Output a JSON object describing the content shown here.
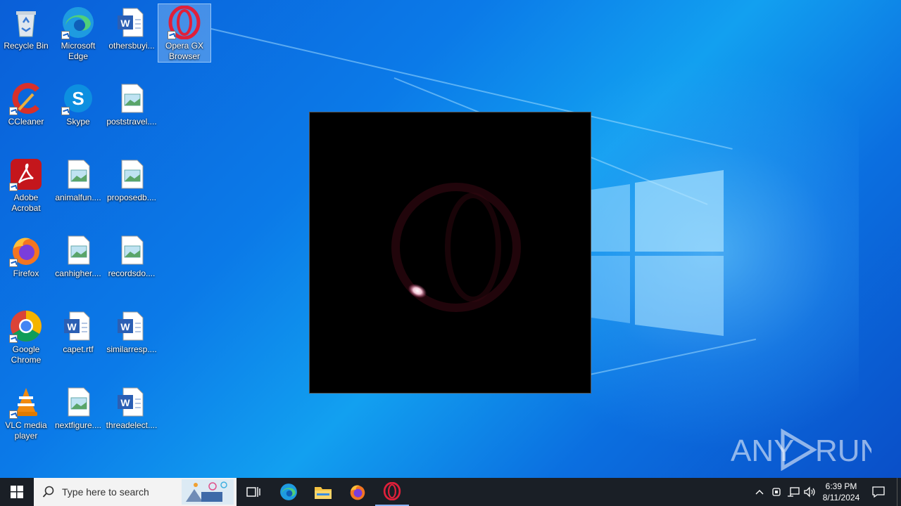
{
  "desktop": {
    "icons": [
      {
        "label": "Recycle Bin",
        "icon": "recycle-bin-icon"
      },
      {
        "label": "Microsoft Edge",
        "icon": "edge-icon"
      },
      {
        "label": "othersbuyi...",
        "icon": "word-document-icon"
      },
      {
        "label": "Opera GX Browser",
        "icon": "opera-gx-icon"
      },
      {
        "label": "CCleaner",
        "icon": "ccleaner-icon"
      },
      {
        "label": "Skype",
        "icon": "skype-icon"
      },
      {
        "label": "poststravel....",
        "icon": "image-file-icon"
      },
      {
        "label": "Adobe Acrobat",
        "icon": "adobe-acrobat-icon"
      },
      {
        "label": "animalfun....",
        "icon": "image-file-icon"
      },
      {
        "label": "proposedb....",
        "icon": "image-file-icon"
      },
      {
        "label": "Firefox",
        "icon": "firefox-icon"
      },
      {
        "label": "canhigher....",
        "icon": "image-file-icon"
      },
      {
        "label": "recordsdo....",
        "icon": "image-file-icon"
      },
      {
        "label": "Google Chrome",
        "icon": "chrome-icon"
      },
      {
        "label": "capet.rtf",
        "icon": "word-document-icon"
      },
      {
        "label": "similarresp....",
        "icon": "word-document-icon"
      },
      {
        "label": "VLC media player",
        "icon": "vlc-icon"
      },
      {
        "label": "nextfigure....",
        "icon": "image-file-icon"
      },
      {
        "label": "threadelect....",
        "icon": "word-document-icon"
      }
    ]
  },
  "watermark": {
    "text": "ANY RUN"
  },
  "taskbar": {
    "search_placeholder": "Type here to search",
    "pinned": [
      "task-view-icon",
      "edge-icon",
      "file-explorer-icon",
      "firefox-icon",
      "opera-gx-icon"
    ],
    "clock": {
      "time": "6:39 PM",
      "date": "8/11/2024"
    }
  },
  "colors": {
    "desktop_blue": "#0b7ae8",
    "taskbar": "#1a1f26",
    "opera_red": "#e0203a"
  }
}
